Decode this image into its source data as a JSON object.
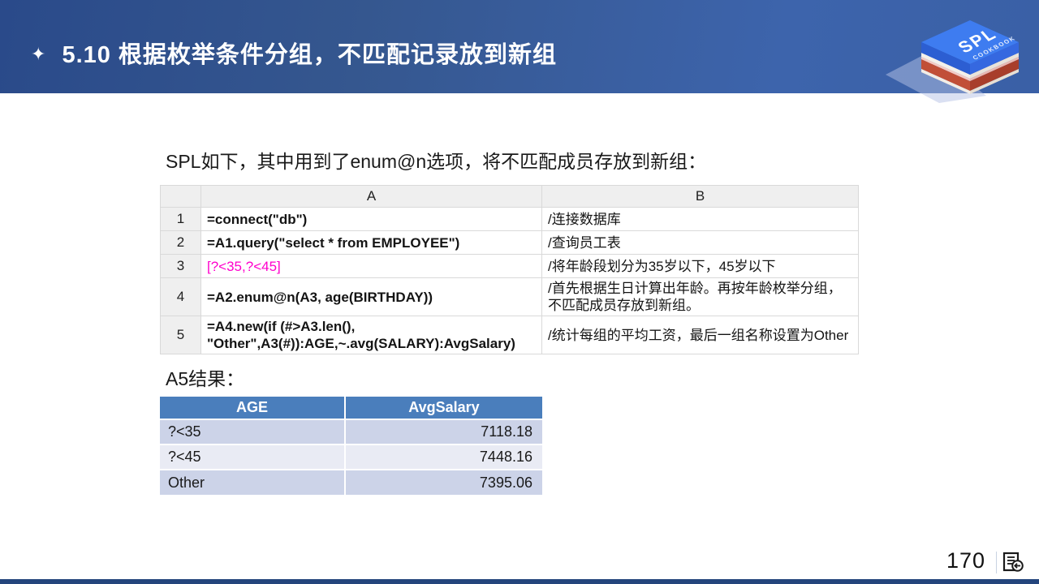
{
  "header": {
    "bullet": "✦",
    "title": "5.10  根据枚举条件分组，不匹配记录放到新组",
    "logo": {
      "line1": "SPL",
      "line2": "COOKBOOK"
    }
  },
  "content": {
    "intro": "SPL如下，其中用到了enum@n选项，将不匹配成员存放到新组：",
    "result_label": "A5结果："
  },
  "spl_table": {
    "columns": [
      "A",
      "B"
    ],
    "rows": [
      {
        "num": "1",
        "code": "=connect(\"db\")",
        "comment": "/连接数据库"
      },
      {
        "num": "2",
        "code": "=A1.query(\"select * from EMPLOYEE\")",
        "comment": "/查询员工表"
      },
      {
        "num": "3",
        "code": "[?<35,?<45]",
        "comment": "/将年龄段划分为35岁以下，45岁以下"
      },
      {
        "num": "4",
        "code": "=A2.enum@n(A3, age(BIRTHDAY))",
        "comment": "/首先根据生日计算出年龄。再按年龄枚举分组，不匹配成员存放到新组。"
      },
      {
        "num": "5",
        "code": "=A4.new(if (#>A3.len(),\n\"Other\",A3(#)):AGE,~.avg(SALARY):AvgSalary)",
        "comment": "/统计每组的平均工资，最后一组名称设置为Other"
      }
    ]
  },
  "result_table": {
    "headers": [
      "AGE",
      "AvgSalary"
    ],
    "rows": [
      {
        "age": "?<35",
        "avg_salary": "7118.18"
      },
      {
        "age": "?<45",
        "avg_salary": "7448.16"
      },
      {
        "age": "Other",
        "avg_salary": "7395.06"
      }
    ]
  },
  "footer": {
    "page_number": "170"
  },
  "colors": {
    "header_gradient_start": "#2a4a8a",
    "header_gradient_end": "#3d64ac",
    "code_highlight": "#ff00cc",
    "result_header_bg": "#4a7ebc",
    "result_row_odd": "#ccd3e8",
    "result_row_even": "#e9ebf4",
    "book_blue": "#3e7cf0",
    "book_red": "#c14f38",
    "bottom_bar": "#24457c"
  }
}
